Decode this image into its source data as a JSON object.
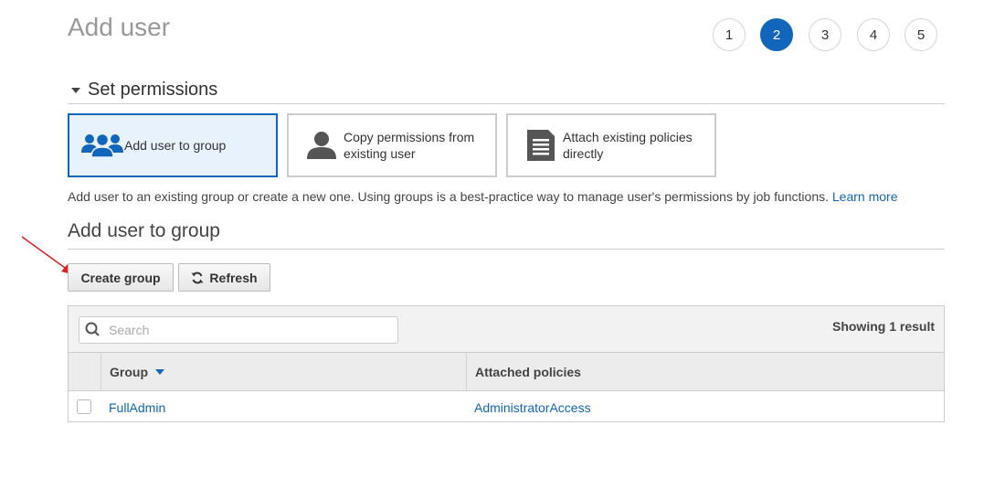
{
  "page": {
    "title": "Add user"
  },
  "steps": [
    "1",
    "2",
    "3",
    "4",
    "5"
  ],
  "permissions": {
    "section_title": "Set permissions",
    "options": [
      {
        "label": "Add user to group",
        "icon": "users-group-icon"
      },
      {
        "label": "Copy permissions from existing user",
        "icon": "user-icon"
      },
      {
        "label": "Attach existing policies directly",
        "icon": "document-icon"
      }
    ],
    "description": "Add user to an existing group or create a new one. Using groups is a best-practice way to manage user's permissions by job functions.",
    "learn_more": "Learn more"
  },
  "group_section": {
    "title": "Add user to group",
    "create_button": "Create group",
    "refresh_button": "Refresh"
  },
  "table": {
    "search_placeholder": "Search",
    "showing": "Showing 1 result",
    "columns": [
      "Group",
      "Attached policies"
    ],
    "rows": [
      {
        "group": "FullAdmin",
        "policies": "AdministratorAccess"
      }
    ]
  },
  "colors": {
    "accent": "#1166bb",
    "selected_bg": "#e8f2fc",
    "annotation_arrow": "#e02020"
  }
}
